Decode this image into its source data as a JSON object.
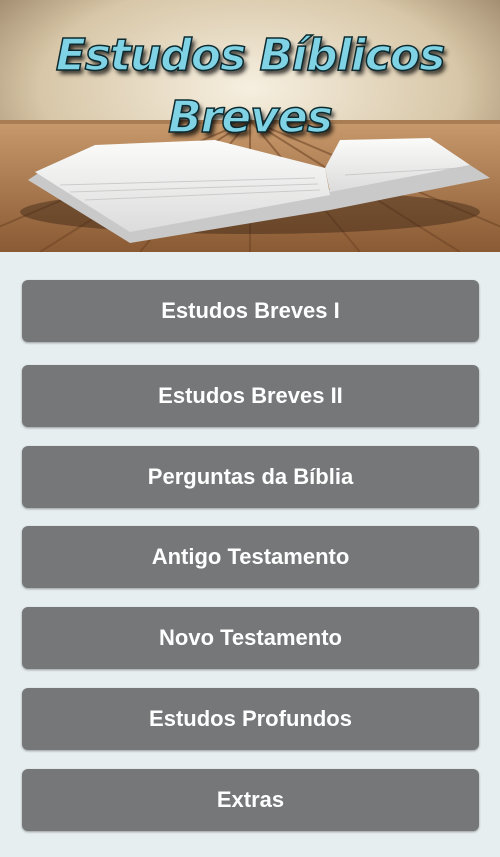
{
  "header": {
    "title_line1": "Estudos Bíblicos",
    "title_line2": "Breves"
  },
  "menu": [
    {
      "label": "Estudos Breves I"
    },
    {
      "label": "Estudos Breves II"
    },
    {
      "label": "Perguntas da Bíblia"
    },
    {
      "label": "Antigo Testamento"
    },
    {
      "label": "Novo Testamento"
    },
    {
      "label": "Estudos Profundos"
    },
    {
      "label": "Extras"
    }
  ],
  "colors": {
    "button_bg": "#757778",
    "button_text": "#ffffff",
    "page_bg": "#e7eef0",
    "title_fill": "#7fd3e4"
  }
}
